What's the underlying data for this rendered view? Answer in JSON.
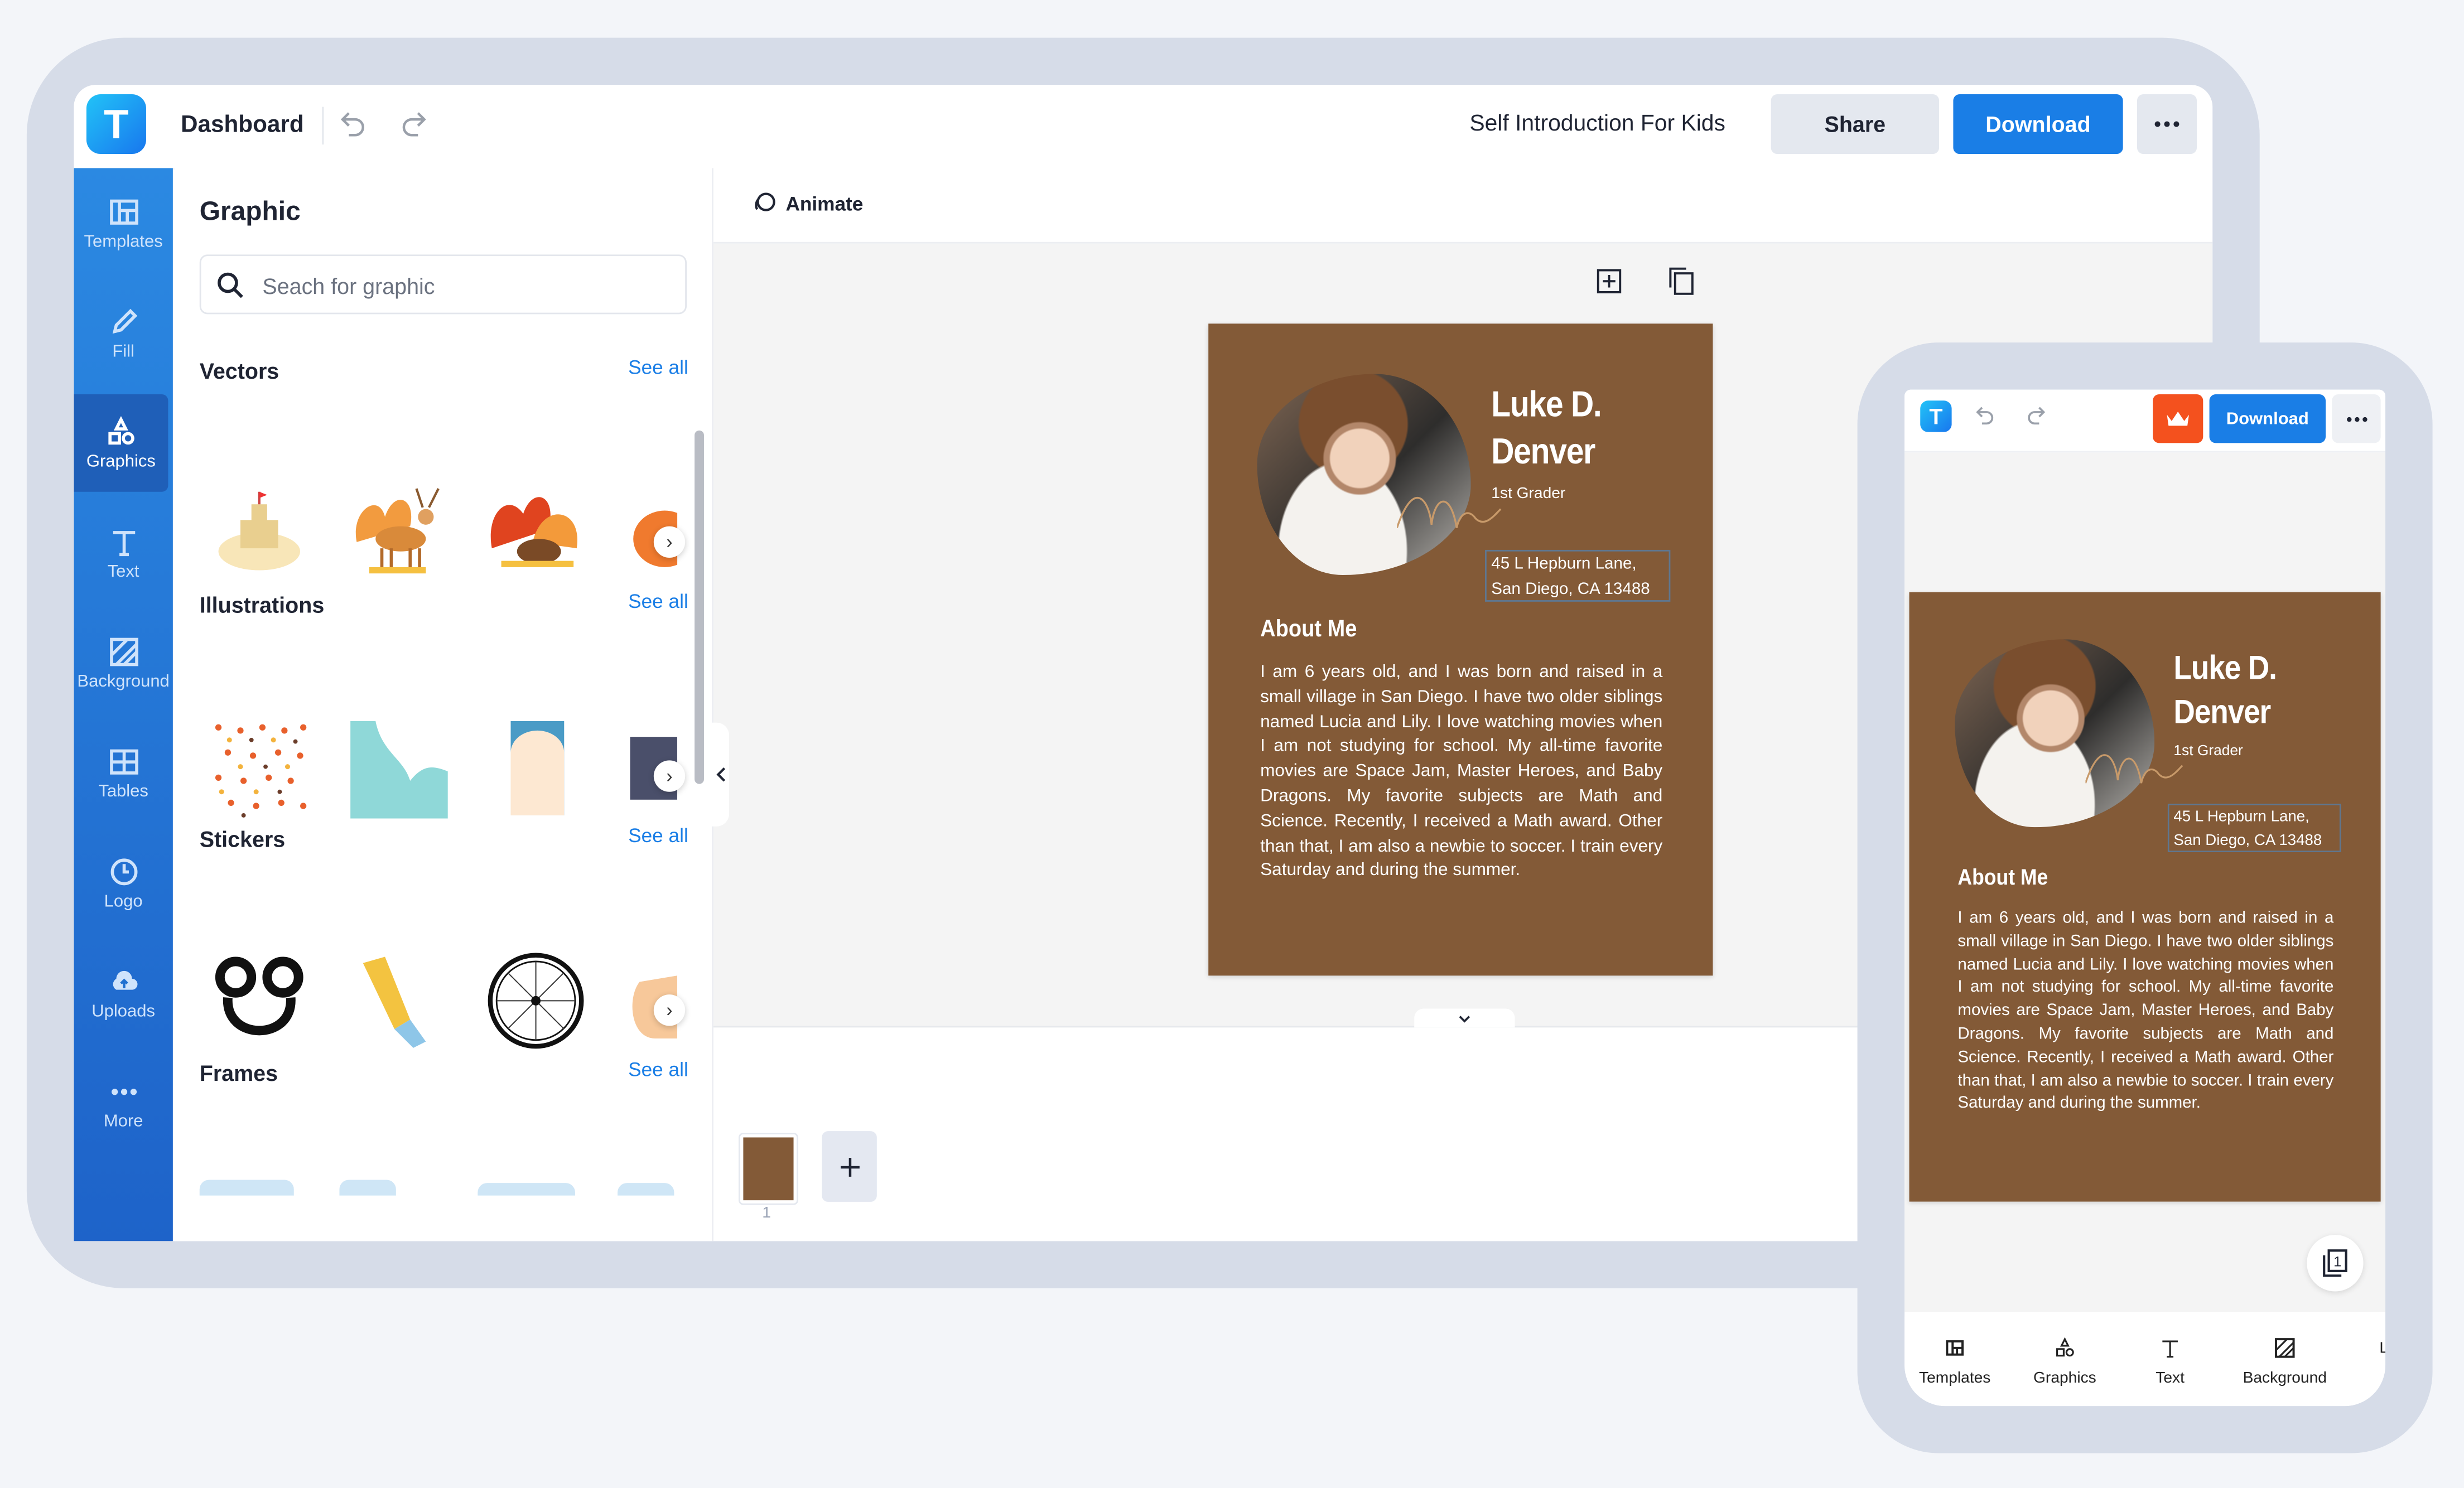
{
  "app": {
    "logo_letter": "T",
    "dashboard_label": "Dashboard",
    "document_title": "Self Introduction For Kids",
    "share_label": "Share",
    "download_label": "Download",
    "more_icon": "ellipsis-icon",
    "brand_color": "#1a7ee6"
  },
  "sidebar": {
    "items": [
      {
        "label": "Templates",
        "icon": "templates-icon"
      },
      {
        "label": "Fill",
        "icon": "pencil-icon"
      },
      {
        "label": "Graphics",
        "icon": "shapes-icon",
        "active": true
      },
      {
        "label": "Text",
        "icon": "text-icon"
      },
      {
        "label": "Background",
        "icon": "background-icon"
      },
      {
        "label": "Tables",
        "icon": "table-icon"
      },
      {
        "label": "Logo",
        "icon": "logo-icon"
      },
      {
        "label": "Uploads",
        "icon": "upload-cloud-icon"
      },
      {
        "label": "More",
        "icon": "ellipsis-icon"
      }
    ]
  },
  "panel": {
    "title": "Graphic",
    "search_placeholder": "Seach for graphic",
    "sections": [
      {
        "title": "Vectors",
        "see_all": "See all"
      },
      {
        "title": "Illustrations",
        "see_all": "See all"
      },
      {
        "title": "Stickers",
        "see_all": "See all"
      },
      {
        "title": "Frames",
        "see_all": "See all"
      }
    ]
  },
  "canvas": {
    "animate_label": "Animate",
    "page_number": "1",
    "page_color": "#835a37"
  },
  "document": {
    "name_line1": "Luke D.",
    "name_line2": "Denver",
    "grade": "1st Grader",
    "address_line1": "45 L Hepburn Lane,",
    "address_line2": "San Diego, CA 13488",
    "about_title": "About Me",
    "about_text": "I am 6 years old, and I was born and raised in a small village in San Diego. I have two older siblings named Lucia and Lily. I love watching movies when I am not studying for school. My all-time favorite movies are Space Jam, Master Heroes, and Baby Dragons. My favorite subjects are Math and Science. Recently, I received a Math award. Other than that, I am also a newbie to soccer. I train every Saturday and during the summer."
  },
  "mobile": {
    "logo_letter": "T",
    "download_label": "Download",
    "premium_color": "#f4511e",
    "page_count": "1",
    "nav": [
      {
        "label": "Templates"
      },
      {
        "label": "Graphics"
      },
      {
        "label": "Text"
      },
      {
        "label": "Background"
      },
      {
        "label": "L"
      }
    ]
  }
}
